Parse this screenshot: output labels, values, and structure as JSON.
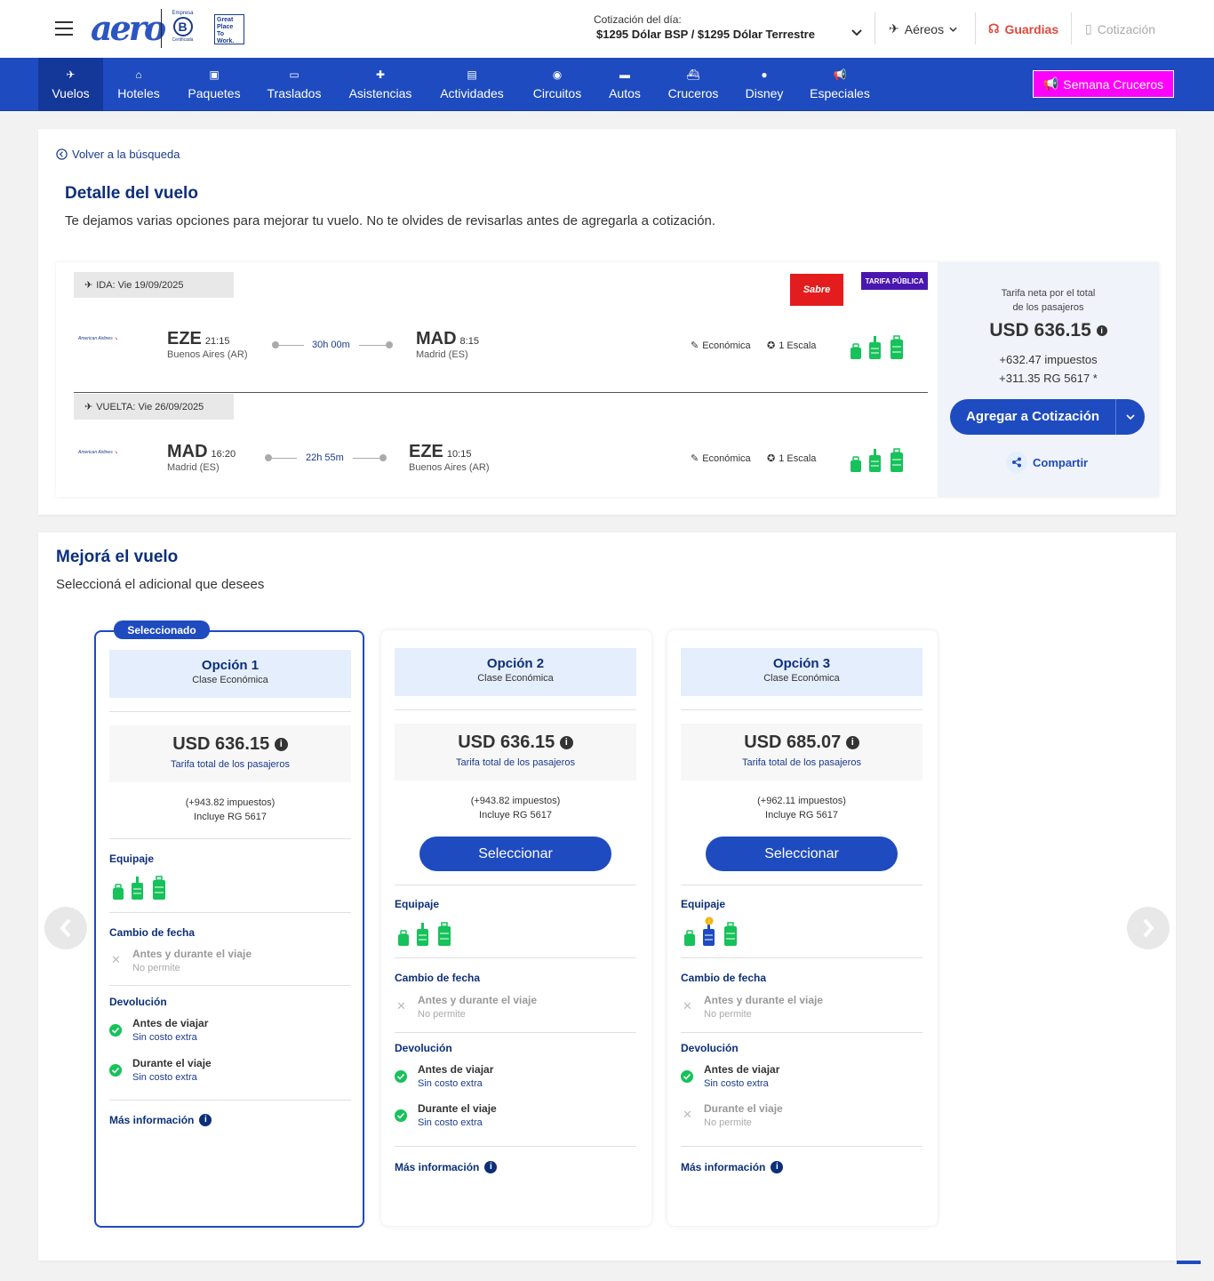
{
  "header": {
    "brand": "aero",
    "bcorp_top": "Empresa",
    "bcorp_mark": "B",
    "bcorp_bottom": "Certificada",
    "gptw": "Great Place To Work.",
    "quote_label": "Cotización del día:",
    "quote_value": "$1295 Dólar BSP / $1295 Dólar Terrestre",
    "aereos": "Aéreos",
    "guardias": "Guardias",
    "cotizacion": "Cotización"
  },
  "nav": {
    "items": [
      {
        "label": "Vuelos",
        "icon": "✈"
      },
      {
        "label": "Hoteles",
        "icon": "⌂"
      },
      {
        "label": "Paquetes",
        "icon": "▣"
      },
      {
        "label": "Traslados",
        "icon": "▭"
      },
      {
        "label": "Asistencias",
        "icon": "✚"
      },
      {
        "label": "Actividades",
        "icon": "▤"
      },
      {
        "label": "Circuitos",
        "icon": "◉"
      },
      {
        "label": "Autos",
        "icon": "▬"
      },
      {
        "label": "Cruceros",
        "icon": "⛴"
      },
      {
        "label": "Disney",
        "icon": "●"
      },
      {
        "label": "Especiales",
        "icon": "📢"
      }
    ],
    "promo": "Semana Cruceros"
  },
  "detail": {
    "back": "Volver a la búsqueda",
    "title": "Detalle del vuelo",
    "subtitle": "Te dejamos varias opciones para mejorar tu vuelo. No te olvides de revisarlas antes de agregarla a cotización.",
    "sabre": "Sabre",
    "tarifa_badge": "TARIFA PÚBLICA",
    "legs": [
      {
        "tag": "IDA: Vie 19/09/2025",
        "airline": "American Airlines",
        "from_code": "EZE",
        "from_time": "21:15",
        "from_city": "Buenos Aires (AR)",
        "duration": "30h 00m",
        "to_code": "MAD",
        "to_time": "8:15",
        "to_city": "Madrid (ES)",
        "cabin": "Económica",
        "stops": "1 Escala"
      },
      {
        "tag": "VUELTA: Vie 26/09/2025",
        "airline": "American Airlines",
        "from_code": "MAD",
        "from_time": "16:20",
        "from_city": "Madrid (ES)",
        "duration": "22h 55m",
        "to_code": "EZE",
        "to_time": "10:15",
        "to_city": "Buenos Aires (AR)",
        "cabin": "Económica",
        "stops": "1 Escala"
      }
    ],
    "price": {
      "label1": "Tarifa neta por el total",
      "label2": "de los pasajeros",
      "amount": "USD 636.15",
      "taxes": "+632.47 impuestos",
      "rg": "+311.35 RG 5617 *",
      "add_button": "Agregar a Cotización",
      "share": "Compartir"
    }
  },
  "improve": {
    "title": "Mejorá el vuelo",
    "subtitle": "Seleccioná el adicional que desees",
    "selected_badge": "Seleccionado",
    "options": [
      {
        "title": "Opción 1",
        "class": "Clase Económica",
        "price": "USD 636.15",
        "price_label": "Tarifa total de los pasajeros",
        "taxes": "(+943.82 impuestos)",
        "rg": "Incluye RG 5617",
        "button": "",
        "equipaje": "Equipaje",
        "cambio": "Cambio de fecha",
        "cambio_t": "Antes y durante el viaje",
        "cambio_d": "No permite",
        "devolucion": "Devolución",
        "dev1_t": "Antes de viajar",
        "dev1_d": "Sin costo extra",
        "dev2_t": "Durante el viaje",
        "dev2_d": "Sin costo extra",
        "more": "Más información"
      },
      {
        "title": "Opción 2",
        "class": "Clase Económica",
        "price": "USD 636.15",
        "price_label": "Tarifa total de los pasajeros",
        "taxes": "(+943.82 impuestos)",
        "rg": "Incluye RG 5617",
        "button": "Seleccionar",
        "equipaje": "Equipaje",
        "cambio": "Cambio de fecha",
        "cambio_t": "Antes y durante el viaje",
        "cambio_d": "No permite",
        "devolucion": "Devolución",
        "dev1_t": "Antes de viajar",
        "dev1_d": "Sin costo extra",
        "dev2_t": "Durante el viaje",
        "dev2_d": "Sin costo extra",
        "more": "Más información"
      },
      {
        "title": "Opción 3",
        "class": "Clase Económica",
        "price": "USD 685.07",
        "price_label": "Tarifa total de los pasajeros",
        "taxes": "(+962.11 impuestos)",
        "rg": "Incluye RG 5617",
        "button": "Seleccionar",
        "equipaje": "Equipaje",
        "cambio": "Cambio de fecha",
        "cambio_t": "Antes y durante el viaje",
        "cambio_d": "No permite",
        "devolucion": "Devolución",
        "dev1_t": "Antes de viajar",
        "dev1_d": "Sin costo extra",
        "dev2_t": "Durante el viaje",
        "dev2_d": "No permite",
        "more": "Más información"
      }
    ]
  },
  "colors": {
    "primary": "#1e4bbf",
    "navy": "#0c2f7a",
    "green": "#16c25a",
    "promo": "#ff00ff",
    "guardias": "#e0483a"
  }
}
